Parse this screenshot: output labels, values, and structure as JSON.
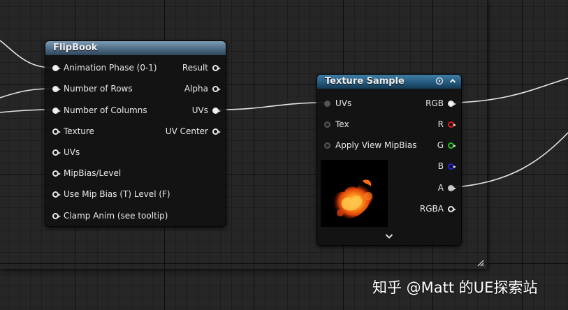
{
  "flipbook": {
    "title": "FlipBook",
    "inputs": [
      "Animation  Phase (0-1)",
      "Number of Rows",
      "Number of Columns",
      "Texture",
      "UVs",
      "MipBias/Level",
      "Use Mip Bias (T) Level (F)",
      "Clamp Anim (see tooltip)"
    ],
    "outputs": [
      "Result",
      "Alpha",
      "UVs",
      "UV Center"
    ]
  },
  "texture_sample": {
    "title": "Texture Sample",
    "inputs": [
      "UVs",
      "Tex",
      "Apply View MipBias"
    ],
    "outputs": [
      "RGB",
      "R",
      "G",
      "B",
      "A",
      "RGBA"
    ],
    "output_colors": {
      "RGB": "#f2f2f2",
      "R": "#e01a1a",
      "G": "#22c322",
      "B": "#2222dd",
      "A": "#c8c8c8",
      "RGBA": "#f2f2f2"
    },
    "preview_icon": "fire-texture-thumbnail",
    "header_icons": [
      "preview-toggle-icon",
      "collapse-caret-icon"
    ],
    "expand_icon": "chevron-down-icon"
  },
  "watermark": "知乎 @Matt 的UE探索站",
  "colors": {
    "canvas_bg": "#262626",
    "flipbook_header": "#5a7891",
    "texture_sample_header": "#2a6488",
    "wire": "#e6e6e6"
  }
}
